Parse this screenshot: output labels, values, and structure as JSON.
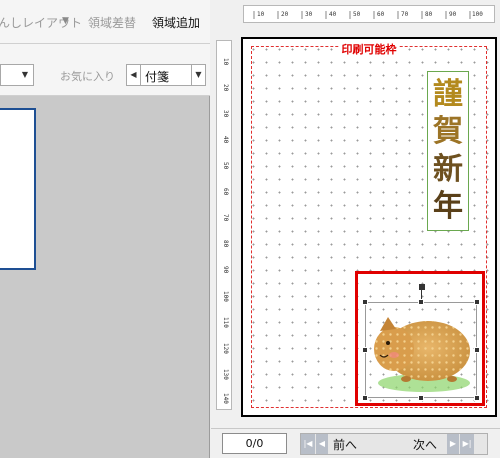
{
  "toolbar_top": {
    "layout_label": "んしレイアウト",
    "region_replace": "領域差替",
    "region_add": "領域追加"
  },
  "toolbar_second": {
    "favorites": "お気に入り",
    "tag_label": "付箋"
  },
  "ruler": {
    "top_labels": [
      "10",
      "20",
      "30",
      "40",
      "50",
      "60",
      "70",
      "80",
      "90",
      "100"
    ],
    "left_labels": [
      "10",
      "20",
      "30",
      "40",
      "50",
      "60",
      "70",
      "80",
      "90",
      "100",
      "110",
      "120",
      "130",
      "140"
    ]
  },
  "canvas": {
    "print_area_label": "印刷可能枠",
    "greeting_chars": [
      "謹",
      "賀",
      "新",
      "年"
    ]
  },
  "navigation": {
    "page_indicator": "0/0",
    "prev_label": "前へ",
    "next_label": "次へ"
  },
  "colors": {
    "selection_border": "#e00000",
    "print_frame": "#e03030",
    "greeting_border": "#6aa84f",
    "preview_border": "#1e4f93"
  },
  "icons": [
    "dropdown-arrow-icon",
    "left-arrow-icon",
    "first-page-icon",
    "prev-page-icon",
    "next-page-icon",
    "last-page-icon",
    "boar-illustration"
  ]
}
